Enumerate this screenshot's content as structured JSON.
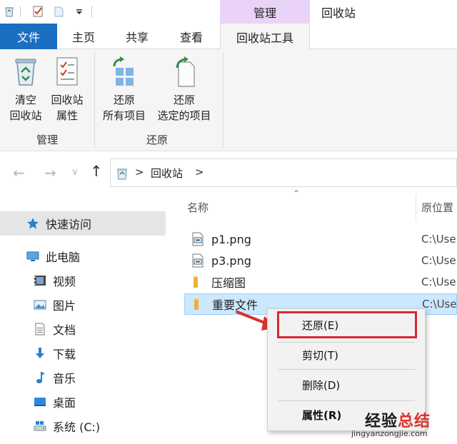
{
  "titlebar": {
    "context_tab_header": "管理",
    "window_title": "回收站",
    "quick_access_icons": [
      "recycle-bin-icon",
      "properties-checkbox-icon",
      "folder-icon",
      "dropdown-arrow-icon"
    ]
  },
  "tabs": {
    "file": "文件",
    "home": "主页",
    "share": "共享",
    "view": "查看",
    "tools": "回收站工具"
  },
  "ribbon": {
    "buttons": [
      {
        "line1": "清空",
        "line2": "回收站",
        "icon": "recycle-bin-icon"
      },
      {
        "line1": "回收站",
        "line2": "属性",
        "icon": "properties-icon"
      },
      {
        "line1": "还原",
        "line2": "所有项目",
        "icon": "restore-all-icon"
      },
      {
        "line1": "还原",
        "line2": "选定的项目",
        "icon": "restore-selected-icon"
      }
    ],
    "groups": [
      "管理",
      "还原"
    ]
  },
  "addressbar": {
    "path": "回收站"
  },
  "sidebar": {
    "items": [
      {
        "label": "快速访问",
        "icon": "star-icon"
      },
      {
        "label": "此电脑",
        "icon": "computer-icon"
      },
      {
        "label": "视频",
        "icon": "video-icon"
      },
      {
        "label": "图片",
        "icon": "picture-icon"
      },
      {
        "label": "文档",
        "icon": "document-icon"
      },
      {
        "label": "下载",
        "icon": "download-icon"
      },
      {
        "label": "音乐",
        "icon": "music-icon"
      },
      {
        "label": "桌面",
        "icon": "desktop-icon"
      },
      {
        "label": "系统 (C:)",
        "icon": "drive-icon"
      }
    ]
  },
  "filelist": {
    "columns": {
      "name": "名称",
      "location": "原位置"
    },
    "rows": [
      {
        "name": "p1.png",
        "location": "C:\\Use",
        "icon": "image-file-icon"
      },
      {
        "name": "p3.png",
        "location": "C:\\Use",
        "icon": "image-file-icon"
      },
      {
        "name": "压缩图",
        "location": "C:\\Use",
        "icon": "folder-icon"
      },
      {
        "name": "重要文件",
        "location": "C:\\Use",
        "icon": "folder-icon"
      }
    ]
  },
  "context_menu": {
    "items": [
      "还原(E)",
      "剪切(T)",
      "删除(D)",
      "属性(R)"
    ]
  },
  "watermark": {
    "title_a": "经验",
    "title_b": "总结",
    "url": "jingyanzongjie.com"
  },
  "colors": {
    "accent_blue": "#1a6fc2",
    "context_tab_purple": "#e9d3f7",
    "selection_blue": "#cce8ff",
    "highlight_red": "#d9282f"
  }
}
